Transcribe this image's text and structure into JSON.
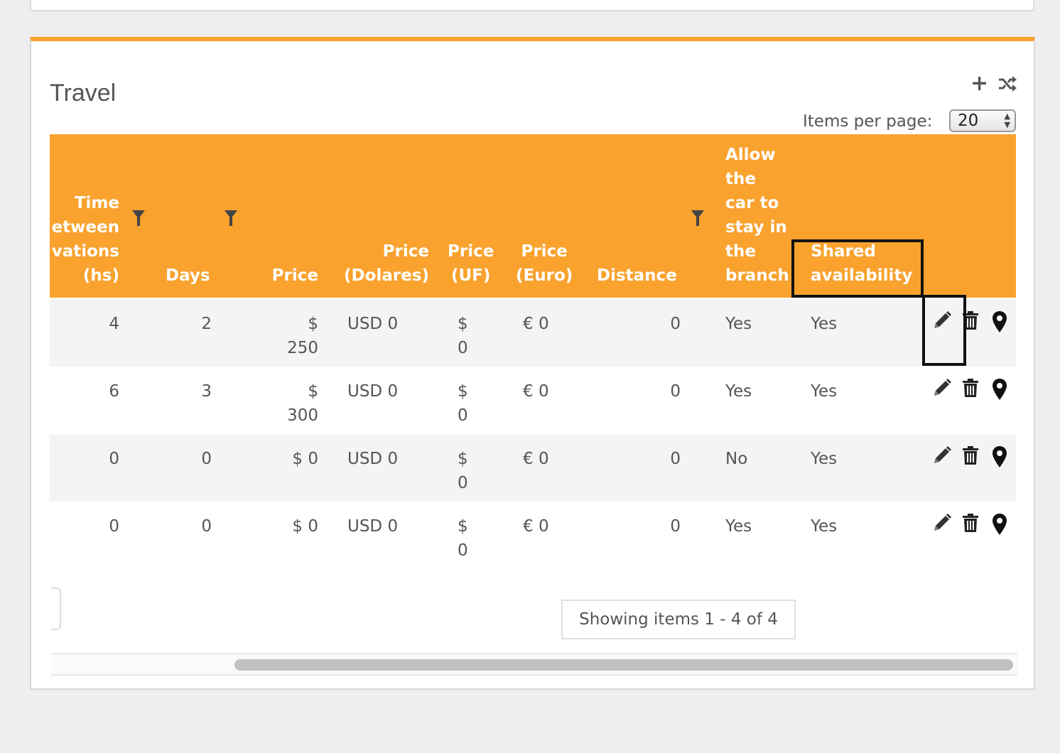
{
  "panel": {
    "title": "Travel",
    "items_per_page_label": "Items per page:",
    "items_per_page_value": "20"
  },
  "columns": [
    {
      "lines": "Time\netween\nvations\n(hs)",
      "filter": true
    },
    {
      "lines": "Days",
      "filter": true
    },
    {
      "lines": "Price",
      "filter": false
    },
    {
      "lines": "Price\n(Dolares)",
      "filter": false
    },
    {
      "lines": "Price\n(UF)",
      "filter": false
    },
    {
      "lines": "Price\n(Euro)",
      "filter": false
    },
    {
      "lines": "Distance",
      "filter": true
    },
    {
      "lines": "Allow\nthe\ncar to\nstay in\nthe\nbranch",
      "filter": false
    },
    {
      "lines": "Shared\navailability",
      "filter": false
    }
  ],
  "rows": [
    {
      "time": "4",
      "days": "2",
      "price": "$\n250",
      "usd": "USD 0",
      "uf": "$\n0",
      "euro": "€ 0",
      "distance": "0",
      "allow": "Yes",
      "shared": "Yes"
    },
    {
      "time": "6",
      "days": "3",
      "price": "$\n300",
      "usd": "USD 0",
      "uf": "$\n0",
      "euro": "€ 0",
      "distance": "0",
      "allow": "Yes",
      "shared": "Yes"
    },
    {
      "time": "0",
      "days": "0",
      "price": "$ 0",
      "usd": "USD 0",
      "uf": "$\n0",
      "euro": "€ 0",
      "distance": "0",
      "allow": "No",
      "shared": "Yes"
    },
    {
      "time": "0",
      "days": "0",
      "price": "$ 0",
      "usd": "USD 0",
      "uf": "$\n0",
      "euro": "€ 0",
      "distance": "0",
      "allow": "Yes",
      "shared": "Yes"
    }
  ],
  "row_actions": [
    "edit-icon",
    "trash-icon",
    "map-pin-icon"
  ],
  "pager": {
    "info": "Showing items 1 - 4 of 4"
  },
  "colors": {
    "accent": "#f9a22e",
    "header_text": "#ffffff",
    "body_text": "#555555"
  }
}
